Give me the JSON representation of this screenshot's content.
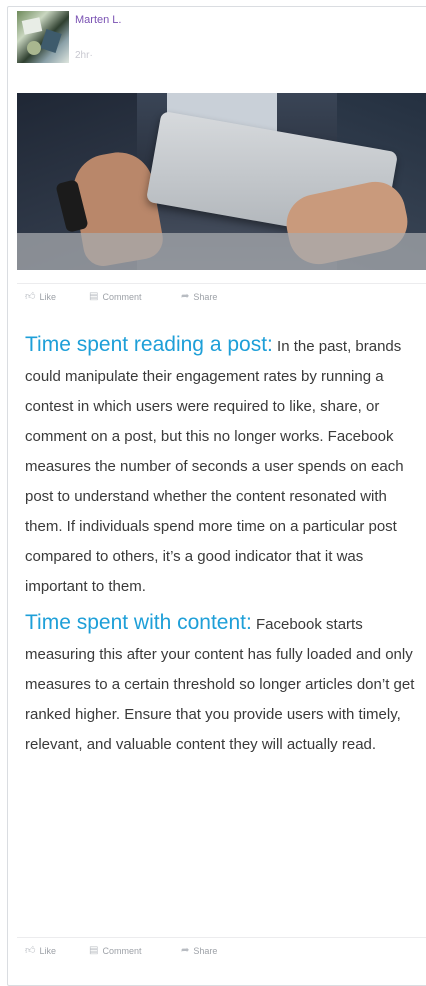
{
  "post": {
    "author": "Marten L.",
    "time": "2hr·"
  },
  "actions": {
    "like": "Like",
    "comment": "Comment",
    "share": "Share"
  },
  "article": {
    "section1_heading": "Time spent reading a post:",
    "section1_body": " In the past, brands could manipulate their engagement rates by running a contest in which users were required to like, share, or comment on a post, but this no longer works. Facebook measures the number of seconds a user spends on each post to understand whether the content resonated with them. If individuals spend more time on a particular post compared to others, it’s a good indicator that it was important to them.",
    "section2_heading": "Time spent with content:",
    "section2_body": " Facebook starts measuring this after your content has fully loaded and only measures to a certain threshold so longer articles don’t get ranked higher. Ensure that you provide users with timely, relevant, and valuable content they will actually read."
  },
  "colors": {
    "author": "#7a52b3",
    "heading": "#1e9fd8",
    "body_text": "#3a3a3a",
    "muted": "#9ea2a8"
  },
  "icons": {
    "like": "thumbs-up-icon",
    "comment": "comment-icon",
    "share": "share-arrow-icon"
  }
}
